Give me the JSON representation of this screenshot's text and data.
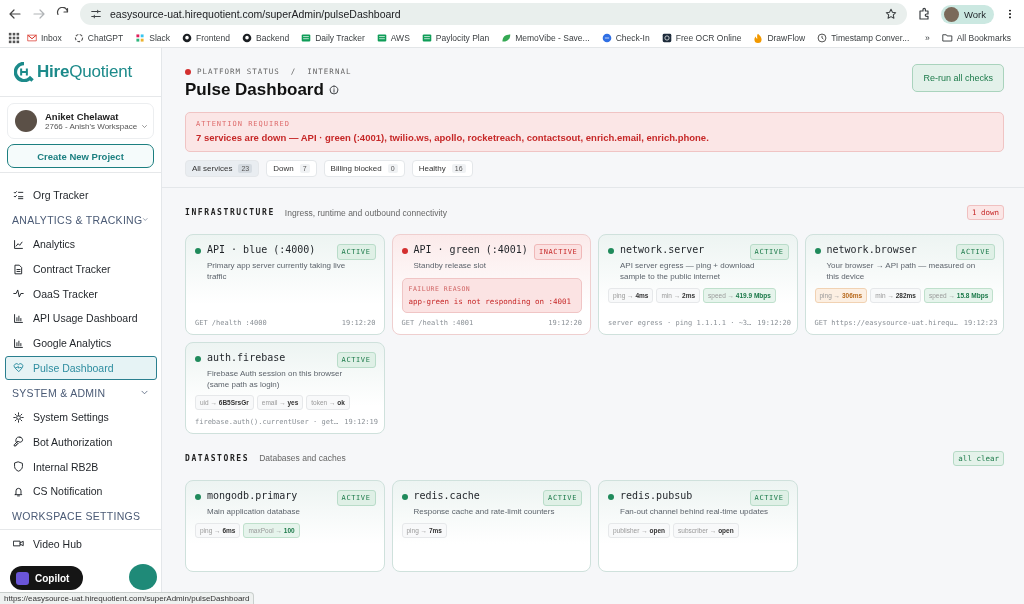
{
  "browser": {
    "url": "easysource-uat.hirequotient.com/superAdmin/pulseDashboard",
    "profile": "Work",
    "bookmarks": [
      "Inbox",
      "ChatGPT",
      "Slack",
      "Frontend",
      "Backend",
      "Daily Tracker",
      "AWS",
      "Paylocity Plan",
      "MemoVibe - Save...",
      "Check-In",
      "Free OCR Online",
      "DrawFlow",
      "Timestamp Conver..."
    ],
    "more": "»",
    "all_bookmarks": "All Bookmarks",
    "status_url": "https://easysource-uat.hirequotient.com/superAdmin/pulseDashboard"
  },
  "sidebar": {
    "brand": "**Hire**Quotient",
    "user": {
      "name": "Aniket Chelawat",
      "workspace": "2766 - Anish's Workspace"
    },
    "create_button": "Create New Project",
    "nav": [
      {
        "kind": "item",
        "label": "Org Tracker",
        "selected": false
      },
      {
        "kind": "heading",
        "label": "ANALYTICS & TRACKING",
        "expanded": true
      },
      {
        "kind": "item",
        "label": "Analytics",
        "selected": false
      },
      {
        "kind": "item",
        "label": "Contract Tracker",
        "selected": false
      },
      {
        "kind": "item",
        "label": "OaaS Tracker",
        "selected": false
      },
      {
        "kind": "item",
        "label": "API Usage Dashboard",
        "selected": false
      },
      {
        "kind": "item",
        "label": "Google Analytics",
        "selected": false
      },
      {
        "kind": "item",
        "label": "Pulse Dashboard",
        "selected": true
      },
      {
        "kind": "heading",
        "label": "SYSTEM & ADMIN",
        "expanded": true
      },
      {
        "kind": "item",
        "label": "System Settings",
        "selected": false
      },
      {
        "kind": "item",
        "label": "Bot Authorization",
        "selected": false
      },
      {
        "kind": "item",
        "label": "Internal RB2B",
        "selected": false
      },
      {
        "kind": "item",
        "label": "CS Notification",
        "selected": false
      },
      {
        "kind": "heading",
        "label": "WORKSPACE SETTINGS"
      }
    ],
    "footer_item": "Video Hub",
    "copilot": "Copilot"
  },
  "main": {
    "breadcrumb": "PLATFORM STATUS  /  INTERNAL",
    "title": "Pulse Dashboard",
    "rerun_button": "Re-run all checks",
    "alert": {
      "label": "ATTENTION REQUIRED",
      "message": "7 services are down — API · green (:4001), twilio.ws, apollo, rocketreach, contactsout, enrich.email, enrich.phone."
    },
    "filters": [
      {
        "label": "All services",
        "count": "23",
        "selected": true
      },
      {
        "label": "Down",
        "count": "7",
        "selected": false
      },
      {
        "label": "Billing blocked",
        "count": "0",
        "selected": false
      },
      {
        "label": "Healthy",
        "count": "16",
        "selected": false
      }
    ],
    "sections": [
      {
        "title": "INFRASTRUCTURE",
        "subtitle": "Ingress, runtime and outbound connectivity",
        "badge": {
          "text": "1 down",
          "alert": true
        },
        "cards": [
          {
            "name": "API · blue (:4000)",
            "down": false,
            "badge": "ACTIVE",
            "description": "Primary app server currently taking live traffic",
            "footer": "GET /health :4000",
            "time": "19:12:20"
          },
          {
            "name": "API · green (:4001)",
            "down": true,
            "badge": "INACTIVE",
            "description": "Standby release slot",
            "failure": {
              "label": "FAILURE REASON",
              "text": "app-green is not responding on :4001"
            },
            "footer": "GET /health :4001",
            "time": "19:12:20"
          },
          {
            "name": "network.server",
            "down": false,
            "badge": "ACTIVE",
            "description": "API server egress — ping + download sample to the public internet",
            "chips": [
              {
                "key": "ping →",
                "value": "4ms",
                "kind": "plain"
              },
              {
                "key": "min →",
                "value": "2ms",
                "kind": "plain"
              },
              {
                "key": "speed →",
                "value": "419.9 Mbps",
                "kind": "good"
              }
            ],
            "footer": "server egress · ping 1.1.1.1 · ~3…",
            "time": "19:12:20"
          },
          {
            "name": "network.browser",
            "down": false,
            "badge": "ACTIVE",
            "description": "Your browser → API path — measured on this device",
            "chips": [
              {
                "key": "ping →",
                "value": "306ms",
                "kind": "warn"
              },
              {
                "key": "min →",
                "value": "282ms",
                "kind": "plain"
              },
              {
                "key": "speed →",
                "value": "15.8 Mbps",
                "kind": "good"
              }
            ],
            "footer": "GET https://easysource-uat.hirequ…",
            "time": "19:12:23"
          },
          {
            "name": "auth.firebase",
            "down": false,
            "badge": "ACTIVE",
            "description": "Firebase Auth session on this browser (same path as login)",
            "chips": [
              {
                "key": "uid →",
                "value": "6B5SrsGr",
                "kind": "plain"
              },
              {
                "key": "email →",
                "value": "yes",
                "kind": "plain"
              },
              {
                "key": "token →",
                "value": "ok",
                "kind": "plain"
              }
            ],
            "footer": "firebase.auth().currentUser · get…",
            "time": "19:12:19"
          }
        ]
      },
      {
        "title": "DATASTORES",
        "subtitle": "Databases and caches",
        "badge": {
          "text": "all clear",
          "alert": false
        },
        "cards": [
          {
            "name": "mongodb.primary",
            "down": false,
            "badge": "ACTIVE",
            "description": "Main application database",
            "chips": [
              {
                "key": "ping →",
                "value": "6ms",
                "kind": "plain"
              },
              {
                "key": "maxPool →",
                "value": "100",
                "kind": "good"
              }
            ]
          },
          {
            "name": "redis.cache",
            "down": false,
            "badge": "ACTIVE",
            "description": "Response cache and rate-limit counters",
            "chips": [
              {
                "key": "ping →",
                "value": "7ms",
                "kind": "plain"
              }
            ]
          },
          {
            "name": "redis.pubsub",
            "down": false,
            "badge": "ACTIVE",
            "description": "Fan-out channel behind real-time updates",
            "chips": [
              {
                "key": "publisher →",
                "value": "open",
                "kind": "plain"
              },
              {
                "key": "subscriber →",
                "value": "open",
                "kind": "plain"
              }
            ]
          }
        ]
      }
    ]
  }
}
